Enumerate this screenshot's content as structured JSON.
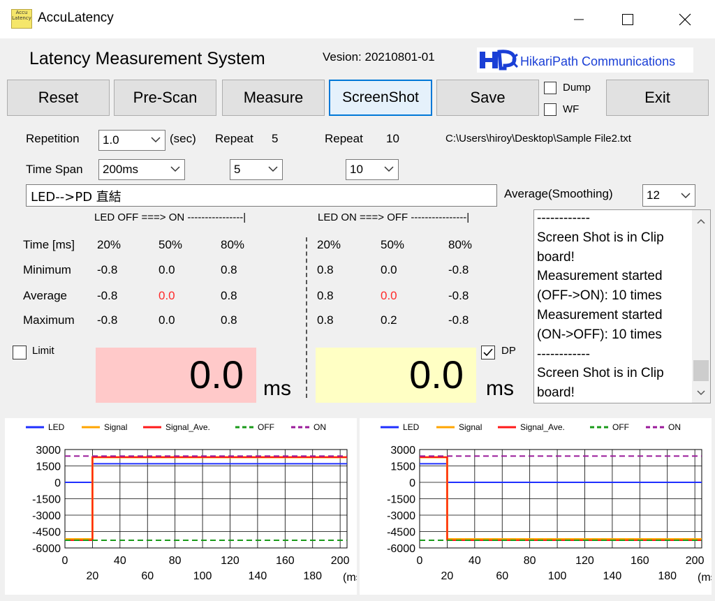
{
  "window": {
    "title": "AccuLatency",
    "icon_text_1": "Accu",
    "icon_text_2": "Latency",
    "minimize_icon": "minimize-icon",
    "maximize_icon": "maximize-icon",
    "close_icon": "close-icon"
  },
  "header": {
    "title": "Latency Measurement System",
    "version": "Vesion: 20210801-01",
    "logo_text": "HikariPath Communications",
    "logo_color": "#1a3fd6"
  },
  "toolbar": {
    "reset": "Reset",
    "prescan": "Pre-Scan",
    "measure": "Measure",
    "screenshot": "ScreenShot",
    "save": "Save",
    "dump": "Dump",
    "wf": "WF",
    "exit": "Exit"
  },
  "settings": {
    "repetition_label": "Repetition",
    "repetition_value": "1.0",
    "repetition_unit": "(sec)",
    "repeat_label_1": "Repeat",
    "repeat_value_1": "5",
    "repeat_label_2": "Repeat",
    "repeat_value_2": "10",
    "file_path": "C:\\Users\\hiroy\\Desktop\\Sample File2.txt",
    "timespan_label": "Time Span",
    "timespan_value": "200ms",
    "repeat_select_1": "5",
    "repeat_select_2": "10",
    "note": "LED-->PD 直結",
    "average_label": "Average(Smoothing)",
    "average_value": "12"
  },
  "results": {
    "left_header": "LED OFF ===> ON ----------------|",
    "right_header": "LED ON ===> OFF ----------------|",
    "row_labels": [
      "Time [ms]",
      "Minimum",
      "Average",
      "Maximum"
    ],
    "left": {
      "cols": [
        "20%",
        "50%",
        "80%"
      ],
      "minimum": [
        "-0.8",
        "0.0",
        "0.8"
      ],
      "average": [
        "-0.8",
        "0.0",
        "0.8"
      ],
      "maximum": [
        "-0.8",
        "0.0",
        "0.8"
      ]
    },
    "right": {
      "cols": [
        "20%",
        "50%",
        "80%"
      ],
      "minimum": [
        "0.8",
        "0.0",
        "-0.8"
      ],
      "average": [
        "0.8",
        "0.0",
        "-0.8"
      ],
      "maximum": [
        "0.8",
        "0.2",
        "-0.8"
      ]
    },
    "limit_label": "Limit",
    "dp_label": "DP",
    "dp_checked": true,
    "left_big": "0.0",
    "right_big": "0.0",
    "unit": "ms",
    "highlight_color": "#ff2a2a",
    "left_bg": "#ffc9c9",
    "right_bg": "#ffffc4"
  },
  "log": {
    "lines": [
      "------------",
      "Screen Shot is in Clip",
      "board!",
      "Measurement started",
      "(OFF->ON): 10 times",
      "Measurement started",
      "(ON->OFF): 10 times",
      "------------",
      "Screen Shot is in Clip",
      "board!"
    ]
  },
  "chart_data": [
    {
      "type": "line",
      "title": "",
      "legend": [
        "LED",
        "Signal",
        "Signal_Ave.",
        "OFF",
        "ON"
      ],
      "legend_placement": "top",
      "colors": {
        "LED": "#1f2fff",
        "Signal": "#ffa500",
        "Signal_Ave.": "#ff1a1a",
        "OFF": "#1a9a1a",
        "ON": "#9a1a9a"
      },
      "xlim": [
        0,
        205
      ],
      "ylim": [
        -6000,
        3000
      ],
      "xticks_top": [
        "0",
        "40",
        "80",
        "120",
        "160",
        "200"
      ],
      "xticks_bottom": [
        "20",
        "60",
        "100",
        "140",
        "180"
      ],
      "xunit": "(ms)",
      "yticks": [
        "3000",
        "1500",
        "0",
        "-1500",
        "-3000",
        "-4500",
        "-6000"
      ],
      "grid": true,
      "series": [
        {
          "name": "LED",
          "x": [
            0,
            20,
            20,
            205
          ],
          "y": [
            0,
            0,
            1700,
            1700
          ]
        },
        {
          "name": "Signal",
          "x": [
            0,
            20,
            20,
            205
          ],
          "y": [
            -5200,
            -5200,
            2300,
            2300
          ]
        },
        {
          "name": "Signal_Ave.",
          "x": [
            0,
            20,
            20,
            205
          ],
          "y": [
            -5300,
            -5300,
            2300,
            2300
          ]
        },
        {
          "name": "OFF",
          "x": [
            0,
            205
          ],
          "y": [
            -5300,
            -5300
          ]
        },
        {
          "name": "ON",
          "x": [
            0,
            205
          ],
          "y": [
            2400,
            2400
          ]
        }
      ]
    },
    {
      "type": "line",
      "title": "",
      "legend": [
        "LED",
        "Signal",
        "Signal_Ave.",
        "OFF",
        "ON"
      ],
      "legend_placement": "top",
      "colors": {
        "LED": "#1f2fff",
        "Signal": "#ffa500",
        "Signal_Ave.": "#ff1a1a",
        "OFF": "#1a9a1a",
        "ON": "#9a1a9a"
      },
      "xlim": [
        0,
        205
      ],
      "ylim": [
        -6000,
        3000
      ],
      "xticks_top": [
        "0",
        "40",
        "80",
        "120",
        "160",
        "200"
      ],
      "xticks_bottom": [
        "20",
        "60",
        "100",
        "140",
        "180"
      ],
      "xunit": "(ms)",
      "yticks": [
        "3000",
        "1500",
        "0",
        "-1500",
        "-3000",
        "-4500",
        "-6000"
      ],
      "grid": true,
      "series": [
        {
          "name": "LED",
          "x": [
            0,
            20,
            20,
            205
          ],
          "y": [
            1700,
            1700,
            0,
            0
          ]
        },
        {
          "name": "Signal",
          "x": [
            0,
            20,
            20,
            205
          ],
          "y": [
            2300,
            2300,
            -5200,
            -5200
          ]
        },
        {
          "name": "Signal_Ave.",
          "x": [
            0,
            20,
            20,
            205
          ],
          "y": [
            2300,
            2300,
            -5300,
            -5300
          ]
        },
        {
          "name": "OFF",
          "x": [
            0,
            205
          ],
          "y": [
            -5300,
            -5300
          ]
        },
        {
          "name": "ON",
          "x": [
            0,
            205
          ],
          "y": [
            2400,
            2400
          ]
        }
      ]
    }
  ]
}
